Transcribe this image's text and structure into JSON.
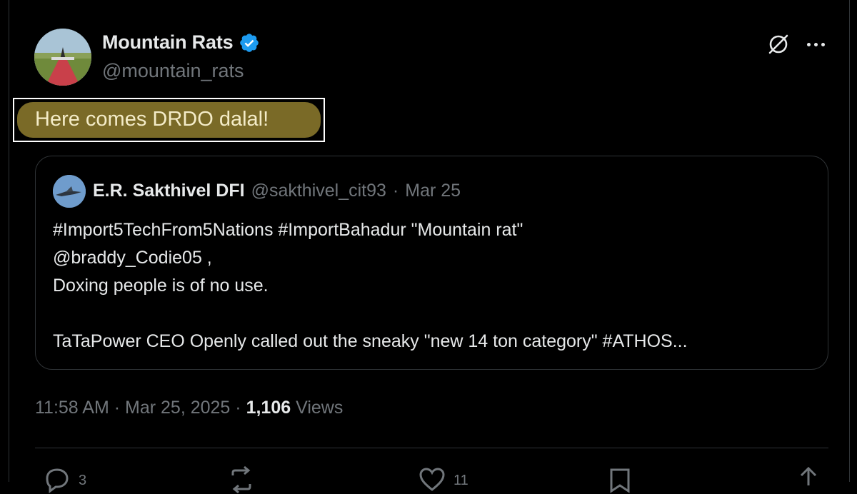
{
  "author": {
    "display_name": "Mountain Rats",
    "handle": "@mountain_rats",
    "verified": true
  },
  "tweet": {
    "text": "Here comes DRDO dalal!"
  },
  "quoted": {
    "display_name": "E.R. Sakthivel DFI",
    "handle": "@sakthivel_cit93",
    "separator": "·",
    "date": "Mar 25",
    "lines": [
      "#Import5TechFrom5Nations #ImportBahadur  \"Mountain rat\"",
      "@braddy_Codie05 ,",
      "Doxing people is of no use.",
      "",
      "TaTaPower CEO Openly called out the sneaky \"new 14 ton category\"  #ATHOS..."
    ]
  },
  "meta": {
    "time": "11:58 AM",
    "sep1": "·",
    "date": "Mar 25, 2025",
    "sep2": "·",
    "views_count": "1,106",
    "views_label": "Views"
  },
  "actions": {
    "replies": "3",
    "likes": "11"
  },
  "colors": {
    "verified_badge": "#1d9bf0",
    "highlight": "#7a6a27",
    "muted_text": "#71767b",
    "border": "#2f3336"
  },
  "icons": [
    "verified-icon",
    "grok-icon",
    "more-icon",
    "reply-icon",
    "retweet-icon",
    "like-icon",
    "bookmark-icon",
    "share-icon"
  ]
}
